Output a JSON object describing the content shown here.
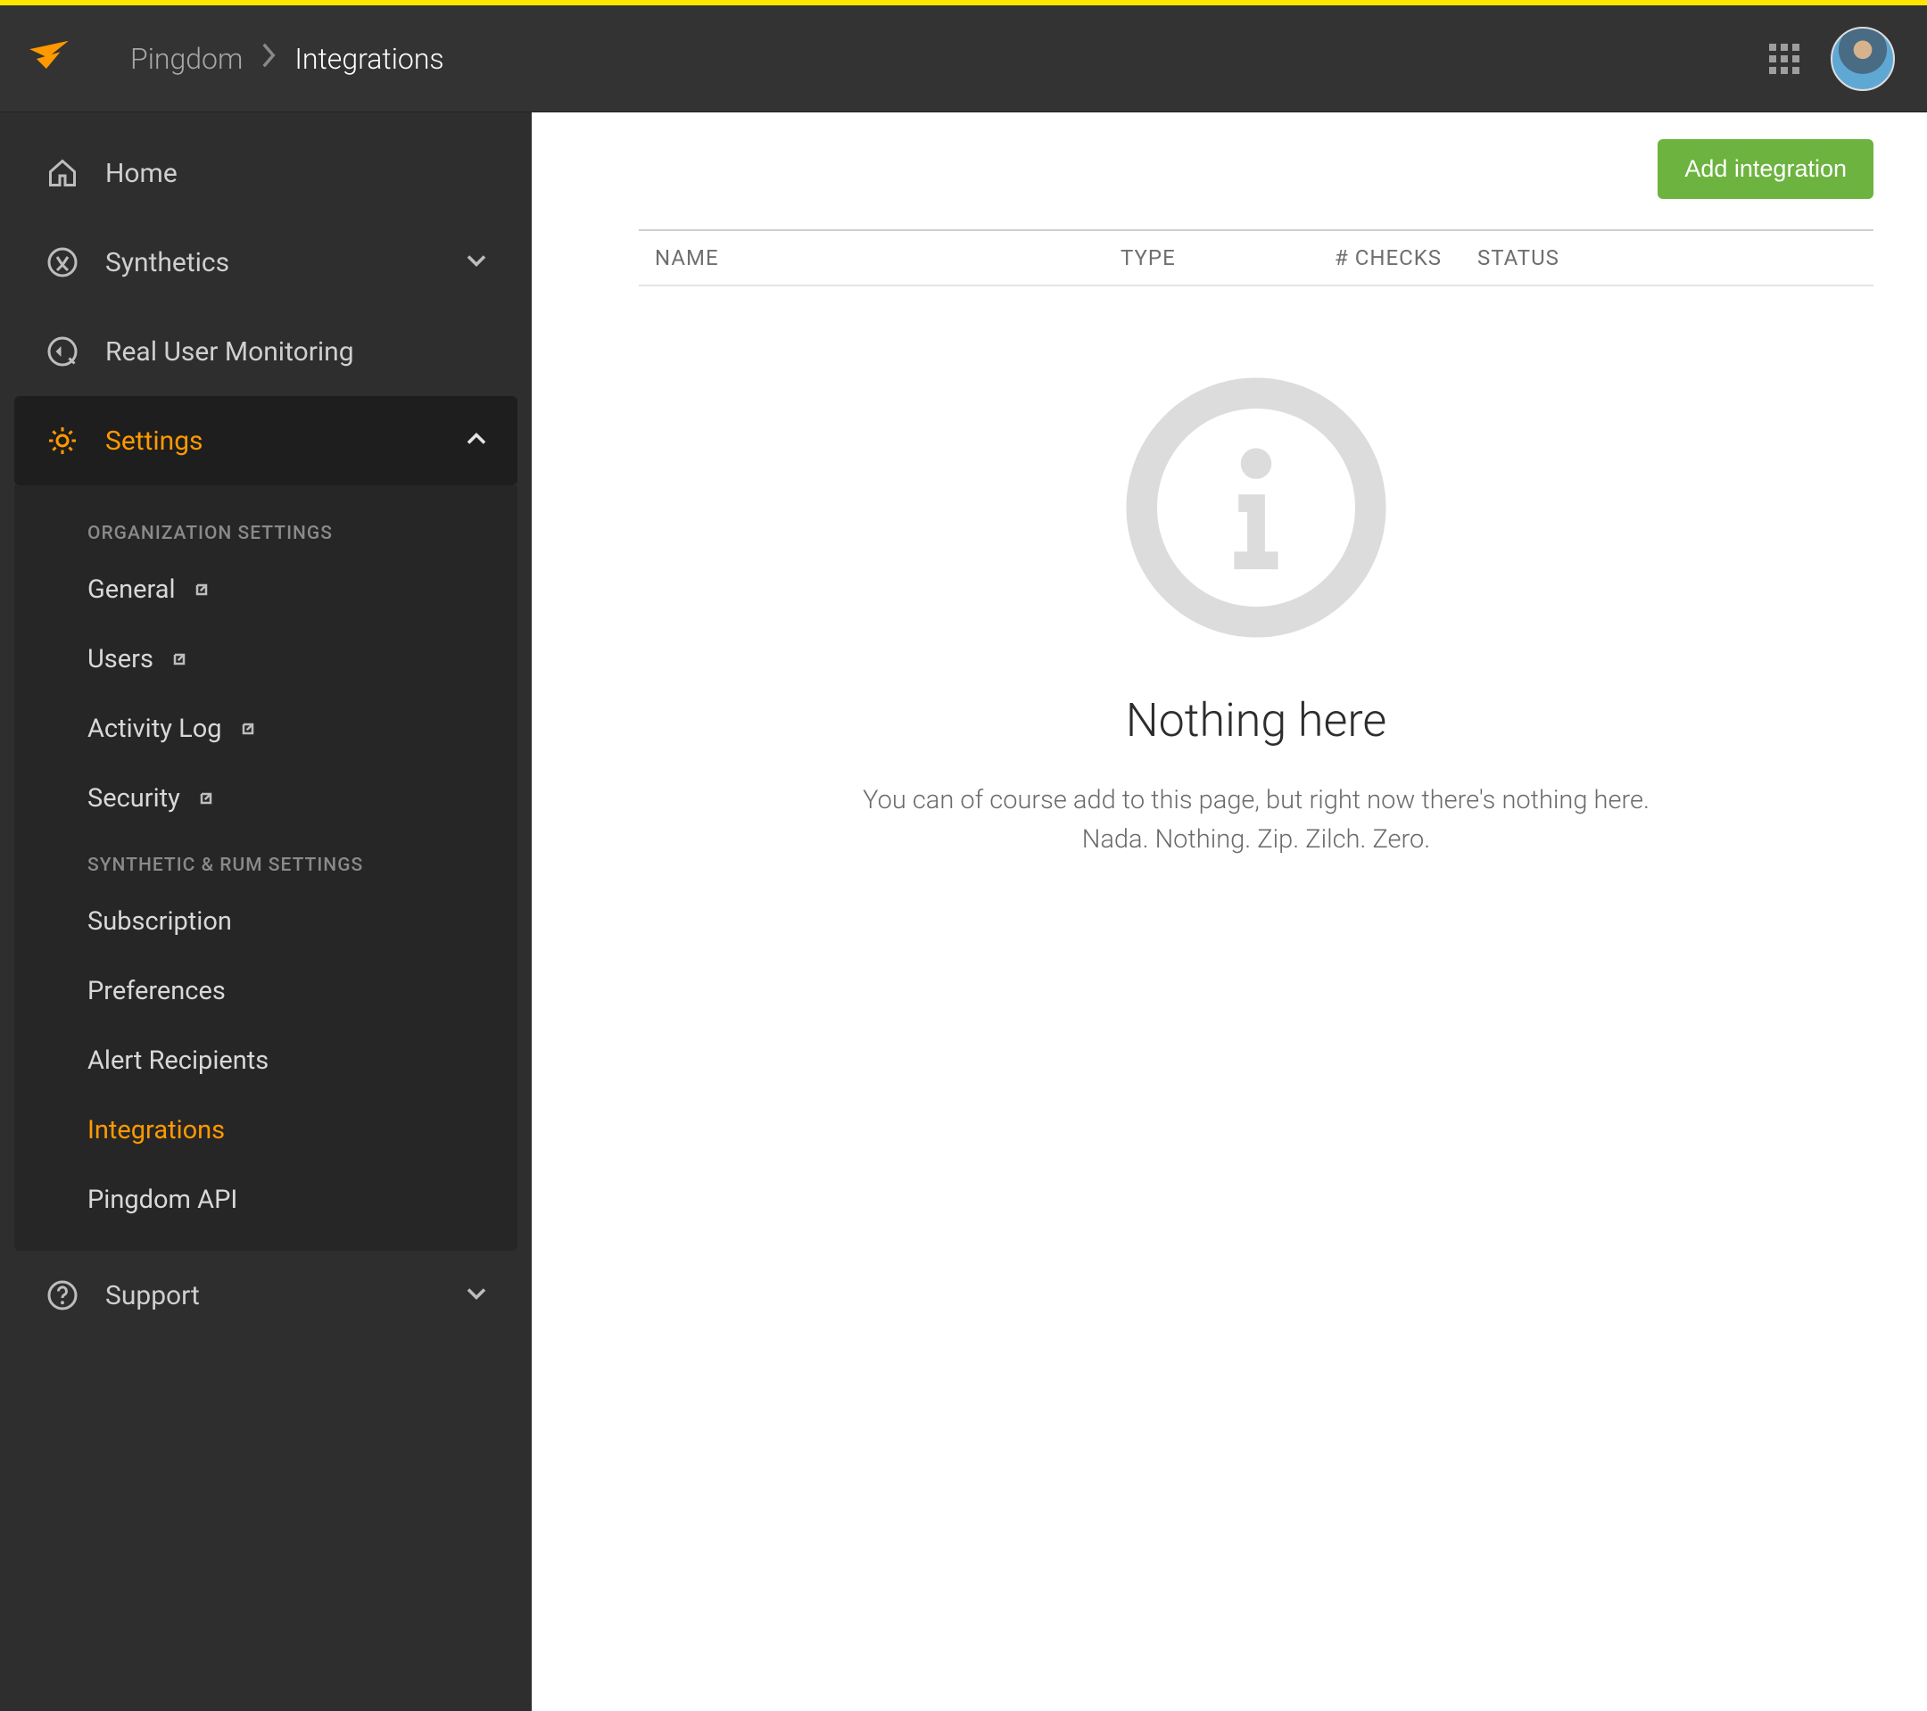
{
  "header": {
    "breadcrumb_parent": "Pingdom",
    "breadcrumb_current": "Integrations"
  },
  "sidebar": {
    "items": [
      {
        "label": "Home"
      },
      {
        "label": "Synthetics"
      },
      {
        "label": "Real User Monitoring"
      },
      {
        "label": "Settings"
      },
      {
        "label": "Support"
      }
    ],
    "settings_groups": [
      {
        "label": "ORGANIZATION SETTINGS",
        "items": [
          {
            "label": "General",
            "external": true
          },
          {
            "label": "Users",
            "external": true
          },
          {
            "label": "Activity Log",
            "external": true
          },
          {
            "label": "Security",
            "external": true
          }
        ]
      },
      {
        "label": "SYNTHETIC & RUM SETTINGS",
        "items": [
          {
            "label": "Subscription"
          },
          {
            "label": "Preferences"
          },
          {
            "label": "Alert Recipients"
          },
          {
            "label": "Integrations",
            "current": true
          },
          {
            "label": "Pingdom API"
          }
        ]
      }
    ]
  },
  "main": {
    "add_button": "Add integration",
    "columns": {
      "name": "NAME",
      "type": "TYPE",
      "checks": "# CHECKS",
      "status": "STATUS"
    },
    "empty": {
      "title": "Nothing here",
      "line1": "You can of course add to this page, but right now there's nothing here.",
      "line2": "Nada. Nothing. Zip. Zilch. Zero."
    }
  },
  "colors": {
    "accent": "#ff9900",
    "primary_button": "#6cb33f"
  }
}
